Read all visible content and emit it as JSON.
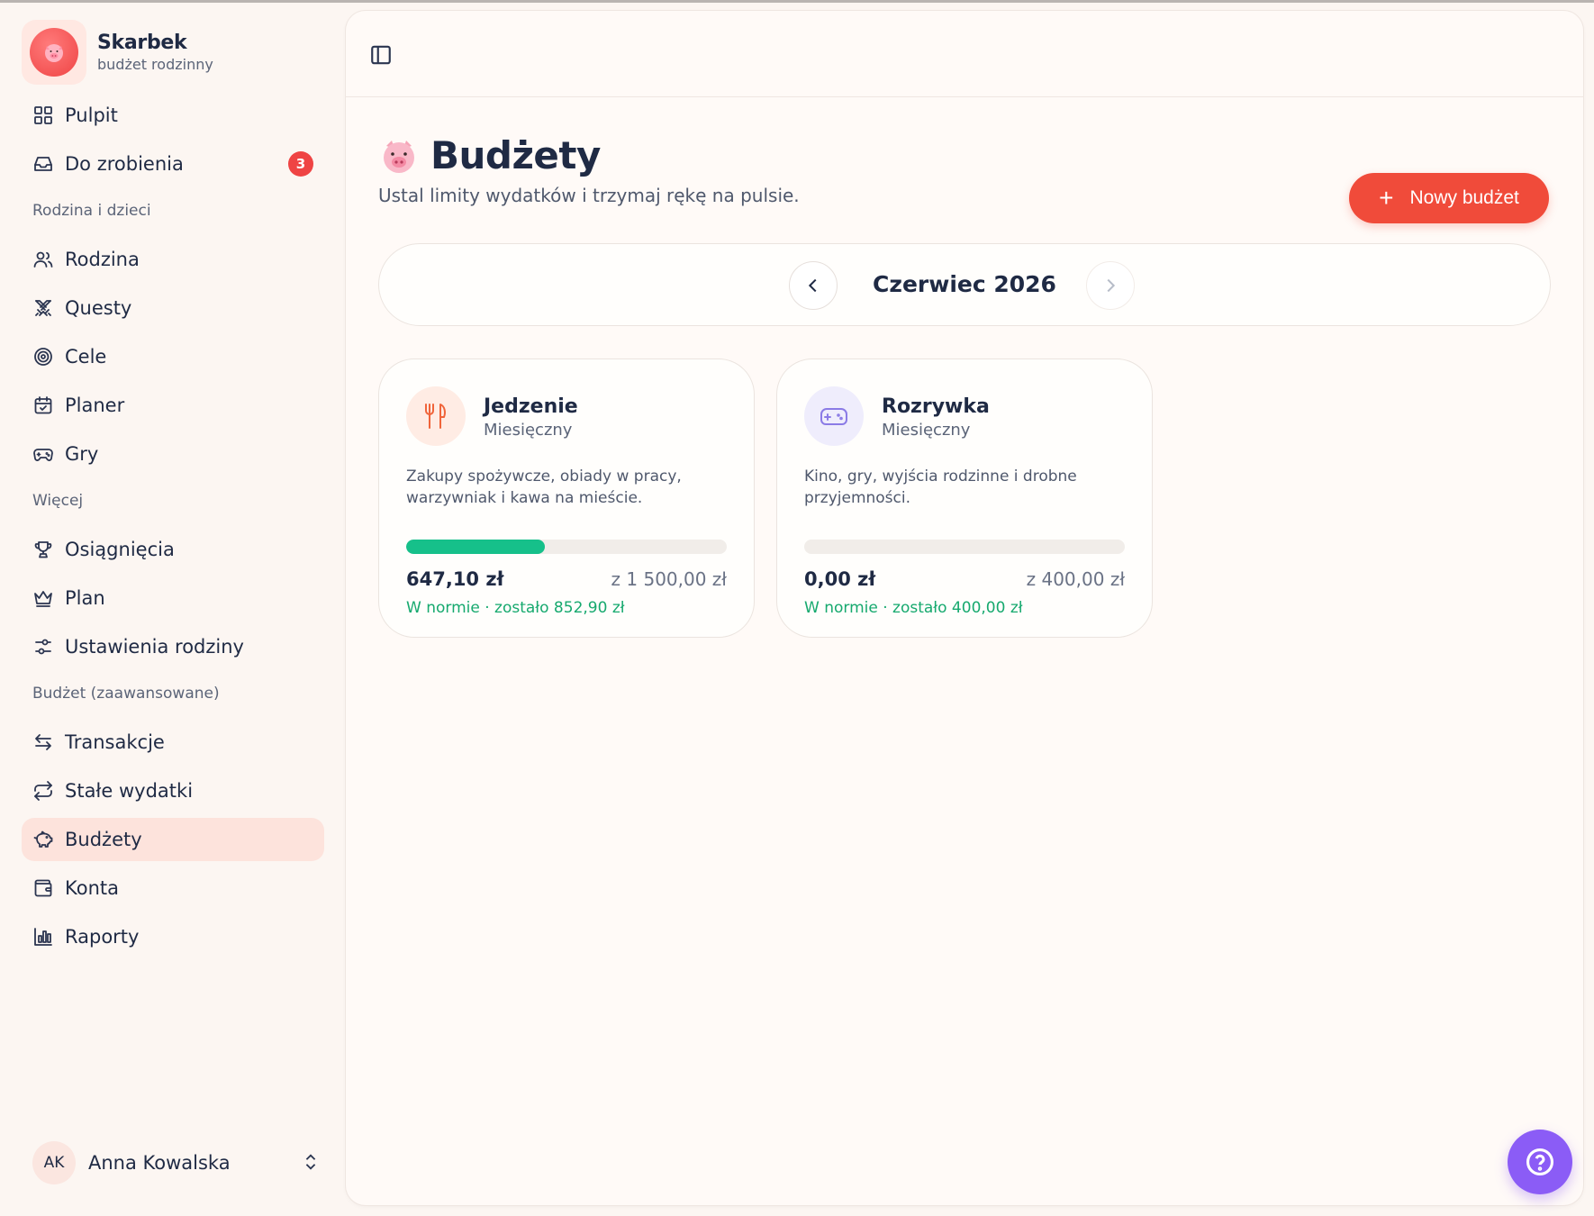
{
  "brand": {
    "name": "Skarbek",
    "subtitle": "budżet rodzinny"
  },
  "nav": {
    "top": [
      {
        "label": "Pulpit",
        "icon": "grid-icon"
      },
      {
        "label": "Do zrobienia",
        "icon": "inbox-icon",
        "badge": "3"
      }
    ],
    "sections": [
      {
        "label": "Rodzina i dzieci",
        "items": [
          {
            "label": "Rodzina",
            "icon": "users-icon"
          },
          {
            "label": "Questy",
            "icon": "swords-icon"
          },
          {
            "label": "Cele",
            "icon": "target-icon"
          },
          {
            "label": "Planer",
            "icon": "calendar-icon"
          },
          {
            "label": "Gry",
            "icon": "gamepad-icon"
          }
        ]
      },
      {
        "label": "Więcej",
        "items": [
          {
            "label": "Osiągnięcia",
            "icon": "trophy-icon"
          },
          {
            "label": "Plan",
            "icon": "crown-icon"
          },
          {
            "label": "Ustawienia rodziny",
            "icon": "sliders-icon"
          }
        ]
      },
      {
        "label": "Budżet (zaawansowane)",
        "items": [
          {
            "label": "Transakcje",
            "icon": "arrows-icon"
          },
          {
            "label": "Stałe wydatki",
            "icon": "repeat-icon"
          },
          {
            "label": "Budżety",
            "icon": "piggy-bank-icon",
            "active": true
          },
          {
            "label": "Konta",
            "icon": "wallet-icon"
          },
          {
            "label": "Raporty",
            "icon": "bar-chart-icon"
          }
        ]
      }
    ]
  },
  "user": {
    "initials": "AK",
    "name": "Anna Kowalska"
  },
  "page": {
    "title": "Budżety",
    "subtitle": "Ustal limity wydatków i trzymaj rękę na pulsie.",
    "new_button": "Nowy budżet",
    "month": "Czerwiec 2026"
  },
  "budgets": [
    {
      "name": "Jedzenie",
      "period": "Miesięczny",
      "description": "Zakupy spożywcze, obiady w pracy, warzywniak i kawa na mieście.",
      "spent": "647,10 zł",
      "limit": "z 1 500,00 zł",
      "progress": 0.4314,
      "status": "W normie · zostało 852,90 zł",
      "icon": "utensils-icon",
      "icon_color": "#f0643a",
      "icon_bg": "#ffece4"
    },
    {
      "name": "Rozrywka",
      "period": "Miesięczny",
      "description": "Kino, gry, wyjścia rodzinne i drobne przyjemności.",
      "spent": "0,00 zł",
      "limit": "z 400,00 zł",
      "progress": 0,
      "status": "W normie · zostało 400,00 zł",
      "icon": "gamepad-icon",
      "icon_color": "#8b7be6",
      "icon_bg": "#efedfc"
    }
  ],
  "colors": {
    "accent": "#f04b3a",
    "success": "#16c08a",
    "help": "#8b5cf6"
  }
}
